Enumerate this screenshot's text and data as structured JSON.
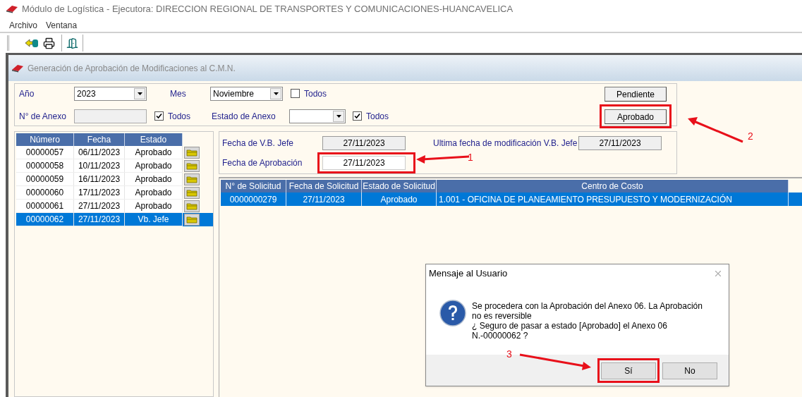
{
  "window": {
    "title": "Módulo de Logística - Ejecutora: DIRECCION REGIONAL DE TRANSPORTES Y COMUNICACIONES-HUANCAVELICA"
  },
  "menu": [
    "Archivo",
    "Ventana"
  ],
  "child_window": {
    "title": "Generación de Aprobación de Modificaciones al C.M.N."
  },
  "filters": {
    "year": {
      "label": "Año",
      "value": "2023"
    },
    "month": {
      "label": "Mes",
      "value": "Noviembre"
    },
    "month_all": {
      "label": "Todos",
      "checked": false
    },
    "annex_number": {
      "label": "N° de Anexo"
    },
    "annex_all": {
      "label": "Todos",
      "checked": true
    },
    "annex_state": {
      "label": "Estado de Anexo"
    },
    "state_all": {
      "label": "Todos",
      "checked": true
    }
  },
  "buttons": [
    {
      "label": "Pendiente",
      "highlighted": false
    },
    {
      "label": "Aprobado",
      "highlighted": true
    }
  ],
  "annex_table": {
    "columns": [
      "Número",
      "Fecha",
      "Estado"
    ],
    "rows": [
      {
        "cells": [
          "00000057",
          "06/11/2023",
          "Aprobado"
        ],
        "selected": false
      },
      {
        "cells": [
          "00000058",
          "10/11/2023",
          "Aprobado"
        ],
        "selected": false
      },
      {
        "cells": [
          "00000059",
          "16/11/2023",
          "Aprobado"
        ],
        "selected": false
      },
      {
        "cells": [
          "00000060",
          "17/11/2023",
          "Aprobado"
        ],
        "selected": false
      },
      {
        "cells": [
          "00000061",
          "27/11/2023",
          "Aprobado"
        ],
        "selected": false
      },
      {
        "cells": [
          "00000062",
          "27/11/2023",
          "Vb. Jefe"
        ],
        "selected": true
      }
    ]
  },
  "vb": {
    "vb_date": {
      "label": "Fecha de V.B. Jefe",
      "value": "27/11/2023"
    },
    "last_modified": {
      "label": "Ultima fecha de modificación V.B. Jefe",
      "value": "27/11/2023"
    },
    "approval_date": {
      "label": "Fecha de Aprobación",
      "value": "27/11/2023",
      "highlighted": true
    }
  },
  "request_table": {
    "columns": [
      "N° de Solicitud",
      "Fecha de Solicitud",
      "Estado de Solicitud",
      "Centro de Costo"
    ],
    "rows": [
      {
        "cells": [
          "0000000279",
          "27/11/2023",
          "Aprobado",
          "1.001 - OFICINA DE PLANEAMIENTO PRESUPUESTO Y MODERNIZACIÓN"
        ],
        "selected": true
      }
    ]
  },
  "dialog": {
    "title": "Mensaje al Usuario",
    "message": "Se procedera con la Aprobación del Anexo 06. La Aprobación\nno es reversible\n¿ Seguro de pasar a estado [Aprobado] el Anexo 06\nN.-00000062 ?",
    "buttons": [
      {
        "label": "Sí",
        "highlighted": true
      },
      {
        "label": "No",
        "highlighted": false
      }
    ]
  },
  "annotations": [
    {
      "label": "1"
    },
    {
      "label": "2"
    },
    {
      "label": "3"
    }
  ]
}
